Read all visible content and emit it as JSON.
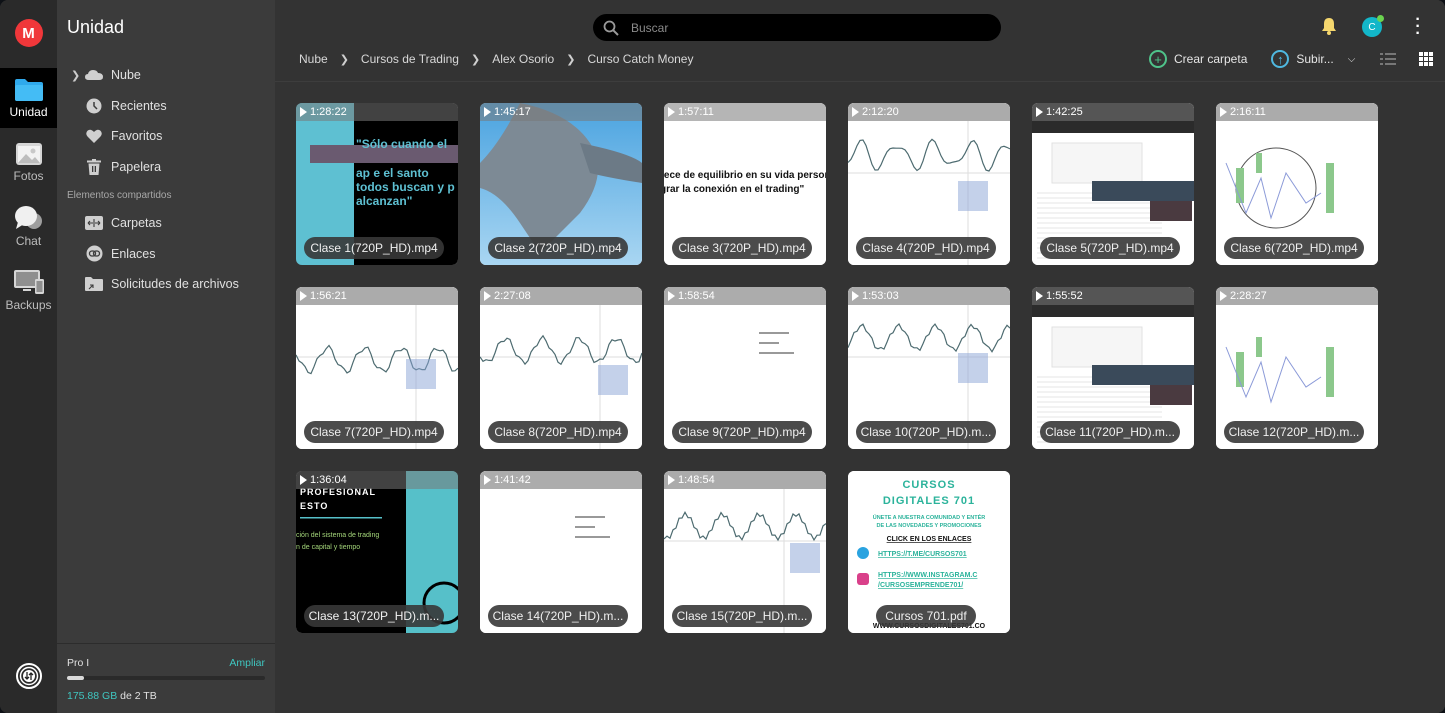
{
  "rail": {
    "logo": "M",
    "items": [
      {
        "label": "Unidad",
        "icon": "folder-icon",
        "active": true
      },
      {
        "label": "Fotos",
        "icon": "photo-icon"
      },
      {
        "label": "Chat",
        "icon": "chat-icon"
      },
      {
        "label": "Backups",
        "icon": "devices-icon"
      }
    ],
    "bottom_icon": "transfer-manager-icon"
  },
  "sidebar": {
    "title": "Unidad",
    "items": [
      {
        "label": "Nube",
        "icon": "cloud-icon"
      },
      {
        "label": "Recientes",
        "icon": "clock-icon"
      },
      {
        "label": "Favoritos",
        "icon": "heart-icon"
      },
      {
        "label": "Papelera",
        "icon": "trash-icon"
      }
    ],
    "shared_section": "Elementos compartidos",
    "shared_items": [
      {
        "label": "Carpetas",
        "icon": "shared-folder-icon"
      },
      {
        "label": "Enlaces",
        "icon": "link-icon"
      },
      {
        "label": "Solicitudes de archivos",
        "icon": "file-request-icon"
      }
    ],
    "storage": {
      "plan": "Pro I",
      "upgrade": "Ampliar",
      "used": "175.88 GB",
      "total_text": " de 2 TB",
      "used_fraction": 0.086
    }
  },
  "header": {
    "search_placeholder": "Buscar",
    "avatar_initial": "C"
  },
  "breadcrumb": [
    "Nube",
    "Cursos de Trading",
    "Alex Osorio",
    "Curso Catch Money"
  ],
  "toolbar": {
    "create_folder": "Crear carpeta",
    "upload": "Subir...",
    "colors": {
      "create": "#4fc38a",
      "upload": "#4fb8e0"
    }
  },
  "files": [
    {
      "name": "Clase 1(720P_HD).mp4",
      "duration": "1:28:22",
      "theme": "teal-black"
    },
    {
      "name": "Clase 2(720P_HD).mp4",
      "duration": "1:45:17",
      "theme": "ocean"
    },
    {
      "name": "Clase 3(720P_HD).mp4",
      "duration": "1:57:11",
      "theme": "white-text"
    },
    {
      "name": "Clase 4(720P_HD).mp4",
      "duration": "2:12:20",
      "theme": "chart"
    },
    {
      "name": "Clase 5(720P_HD).mp4",
      "duration": "1:42:25",
      "theme": "table"
    },
    {
      "name": "Clase 6(720P_HD).mp4",
      "duration": "2:16:11",
      "theme": "chart-light"
    },
    {
      "name": "Clase 7(720P_HD).mp4",
      "duration": "1:56:21",
      "theme": "chart"
    },
    {
      "name": "Clase 8(720P_HD).mp4",
      "duration": "2:27:08",
      "theme": "chart"
    },
    {
      "name": "Clase 9(720P_HD).mp4",
      "duration": "1:58:54",
      "theme": "white"
    },
    {
      "name": "Clase 10(720P_HD).m...",
      "duration": "1:53:03",
      "theme": "chart"
    },
    {
      "name": "Clase 11(720P_HD).m...",
      "duration": "1:55:52",
      "theme": "table"
    },
    {
      "name": "Clase 12(720P_HD).m...",
      "duration": "2:28:27",
      "theme": "chart-light"
    },
    {
      "name": "Clase 13(720P_HD).m...",
      "duration": "1:36:04",
      "theme": "black-teal"
    },
    {
      "name": "Clase 14(720P_HD).m...",
      "duration": "1:41:42",
      "theme": "white"
    },
    {
      "name": "Clase 15(720P_HD).m...",
      "duration": "1:48:54",
      "theme": "chart"
    },
    {
      "name": "Cursos 701.pdf",
      "duration": null,
      "theme": "pdf"
    }
  ],
  "pdf_preview": {
    "title1": "CURSOS",
    "title2": "DIGITALES 701",
    "line1": "ÚNETE A NUESTRA COMUNIDAD Y ENTÉR",
    "line2": "DE LAS NOVEDADES Y PROMOCIONES",
    "cta": "CLICK EN LOS ENLACES",
    "link1": "HTTPS://T.ME/CURSOS701",
    "link2a": "HTTPS://WWW.INSTAGRAM.C",
    "link2b": "/CURSOSEMPRENDE701/",
    "footer": "WWW.CURSOSDIGITALES701.CO"
  }
}
